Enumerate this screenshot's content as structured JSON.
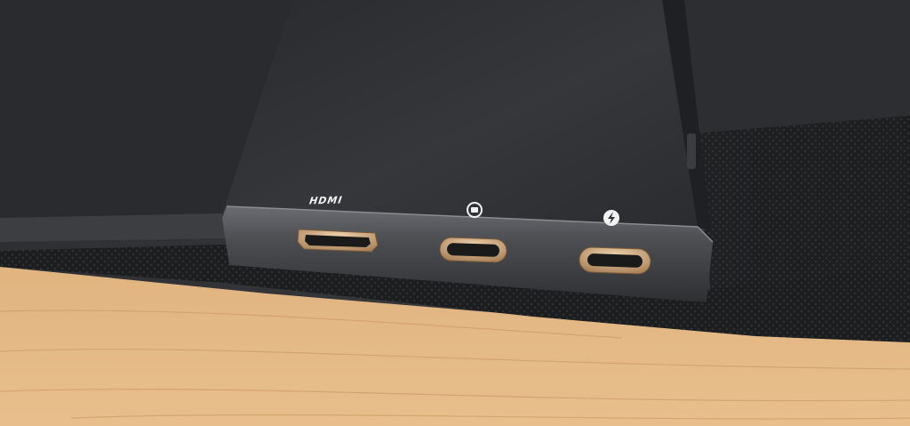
{
  "labels": {
    "hdmi": "HDMI"
  },
  "icons": {
    "usb_c_video": "usb-c-display-icon",
    "usb_c_power": "lightning-power-icon"
  },
  "colors": {
    "desk_wood": "#d9a972",
    "monitor_body": "#2f3033",
    "monitor_edge": "#5b5d62",
    "cover_mat": "#1f2022",
    "port_gold": "#c9a27a"
  }
}
